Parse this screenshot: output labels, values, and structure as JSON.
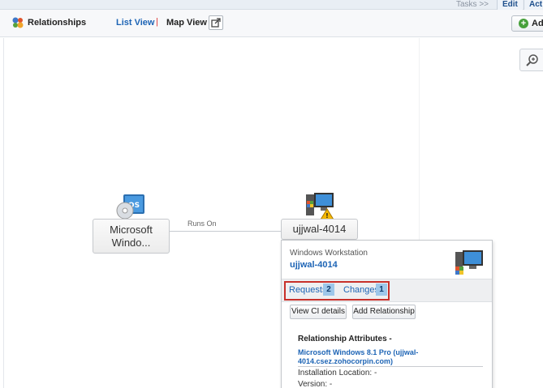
{
  "topbar": {
    "tasks_label": "Tasks >>",
    "edit_label": "Edit",
    "act_label": "Act"
  },
  "toolbar": {
    "title": "Relationships",
    "list_view": "List View",
    "separator": "|",
    "map_view": "Map View",
    "add_label": "Ad"
  },
  "map": {
    "nodes": [
      {
        "label_line1": "Microsoft",
        "label_line2": "Windo...",
        "icon": "os-disc-icon"
      },
      {
        "label": "ujjwal-4014",
        "icon": "workstation-warning-icon"
      }
    ],
    "edge_label": "Runs On"
  },
  "popup": {
    "type": "Windows Workstation",
    "name": "ujjwal-4014",
    "tabs": [
      {
        "label": "Requests",
        "count": "2"
      },
      {
        "label": "Changes",
        "count": "1"
      }
    ],
    "buttons": {
      "view_ci": "View CI details",
      "add_relationship": "Add Relationship"
    },
    "attributes_title": "Relationship Attributes -",
    "related_link": "Microsoft Windows 8.1 Pro (ujjwal-4014.csez.zohocorpin.com)",
    "installation_location": "Installation Location: -",
    "version": "Version: -"
  },
  "colors": {
    "link": "#1d64b5",
    "highlight_border": "#c8302a",
    "badge": "#9ec7ea",
    "add_icon": "#47a03b"
  }
}
